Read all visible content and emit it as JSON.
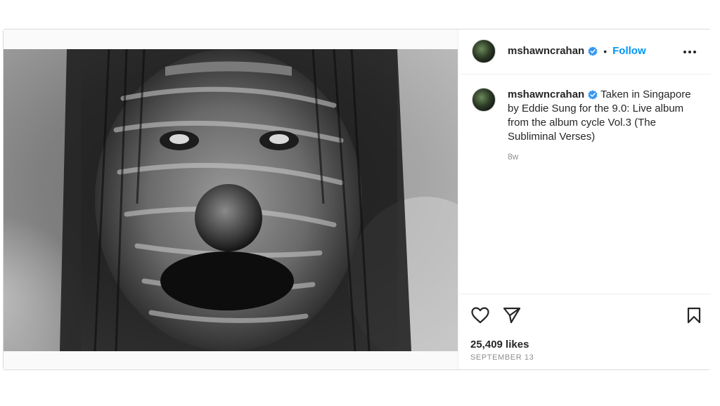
{
  "post": {
    "username": "mshawncrahan",
    "follow_label": "Follow",
    "separator": "•",
    "caption_text": "Taken in Singapore by Eddie Sung for the 9.0: Live album from the album cycle Vol.3 (The Subliminal Verses)",
    "caption_time": "8w",
    "likes": "25,409 likes",
    "date": "SEPTEMBER 13"
  },
  "icons": {
    "verified": "verified-badge-icon",
    "more": "more-options-icon",
    "like": "heart-icon",
    "share": "paper-plane-icon",
    "save": "bookmark-icon"
  },
  "colors": {
    "follow": "#0095f6",
    "verified": "#3897f0",
    "muted": "#8e8e8e"
  }
}
